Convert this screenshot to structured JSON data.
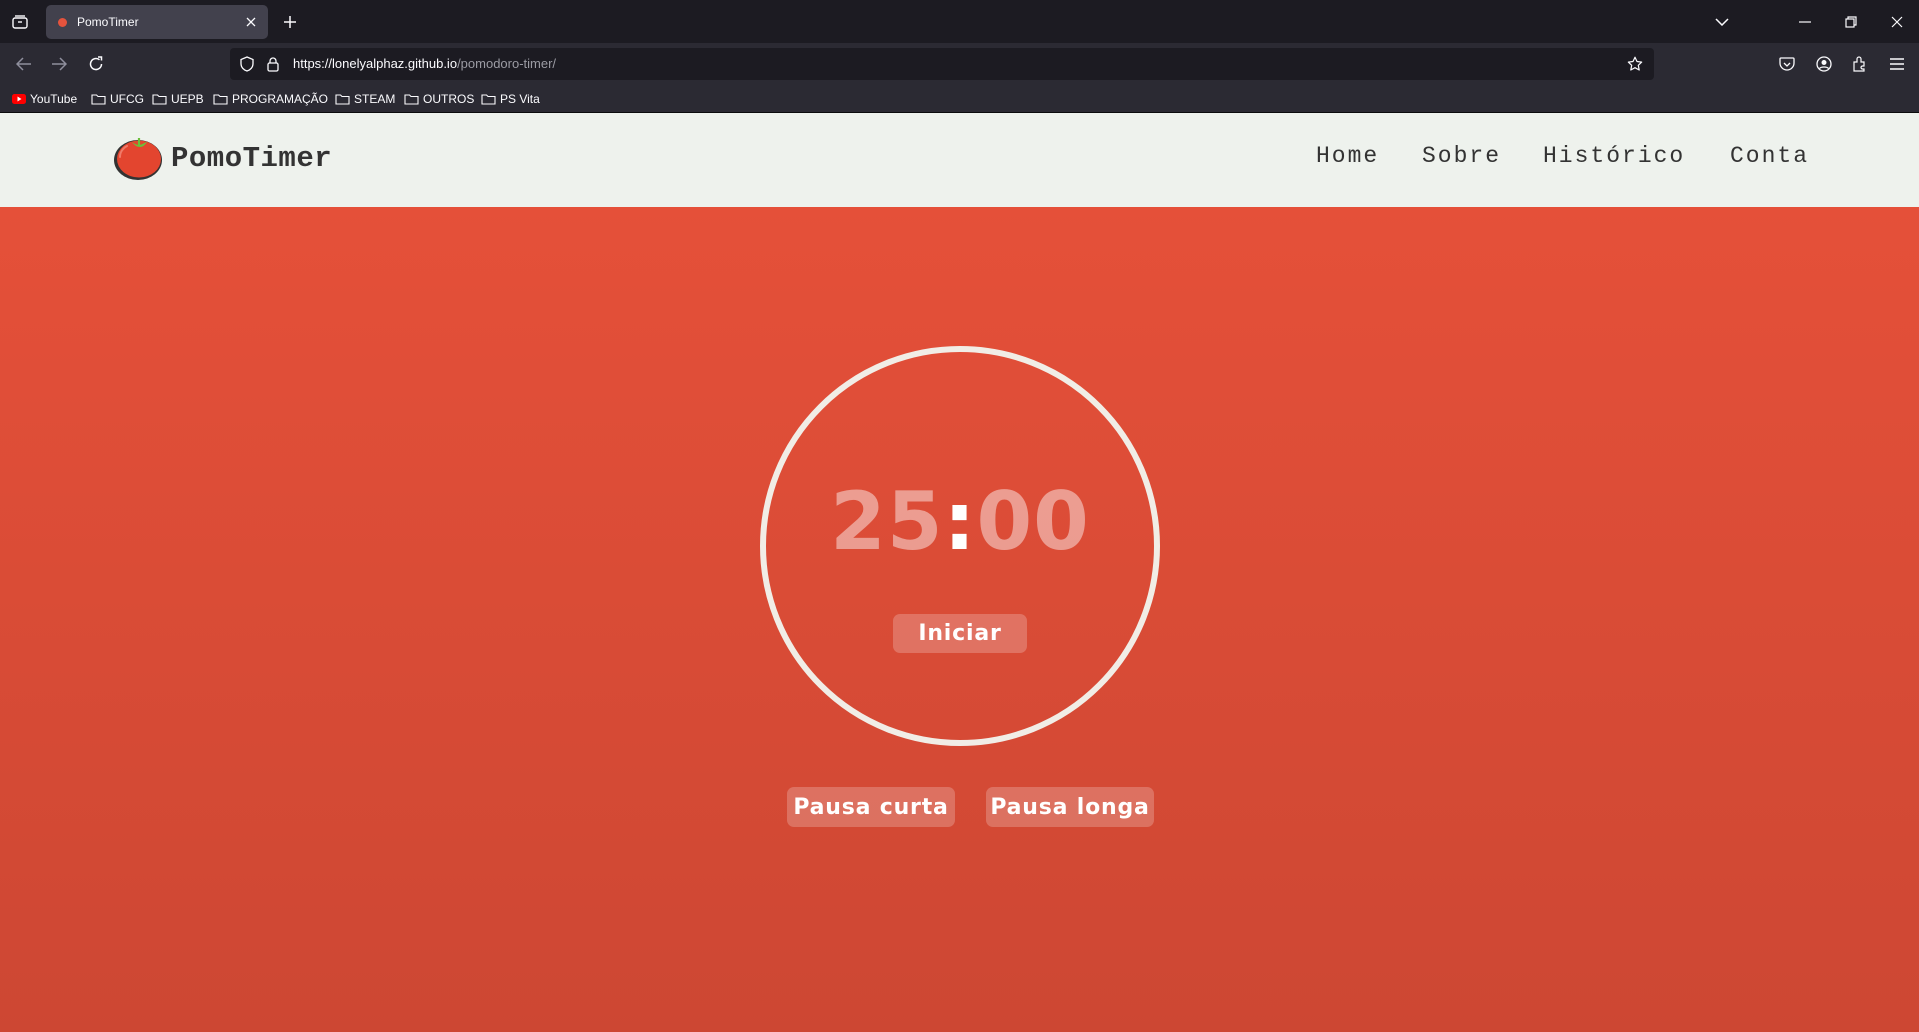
{
  "browser": {
    "tab_title": "PomoTimer",
    "url_host": "https://lonelyalphaz.github.io",
    "url_path": "/pomodoro-timer/",
    "bookmarks": [
      {
        "label": "YouTube",
        "icon": "youtube-icon"
      },
      {
        "label": "UFCG",
        "icon": "folder-icon"
      },
      {
        "label": "UEPB",
        "icon": "folder-icon"
      },
      {
        "label": "PROGRAMAÇÃO",
        "icon": "folder-icon"
      },
      {
        "label": "STEAM",
        "icon": "folder-icon"
      },
      {
        "label": "OUTROS",
        "icon": "folder-icon"
      },
      {
        "label": "PS Vita",
        "icon": "folder-icon"
      }
    ]
  },
  "site": {
    "brand": "PomoTimer",
    "nav": {
      "home": "Home",
      "sobre": "Sobre",
      "historico": "Histórico",
      "conta": "Conta"
    }
  },
  "timer": {
    "minutes": "25",
    "separator": ":",
    "seconds": "00",
    "start_label": "Iniciar"
  },
  "modes": {
    "short_break": "Pausa curta",
    "long_break": "Pausa longa"
  },
  "colors": {
    "accent": "#e55039",
    "header_bg": "#eef2ed",
    "ring": "#f1ede6"
  }
}
